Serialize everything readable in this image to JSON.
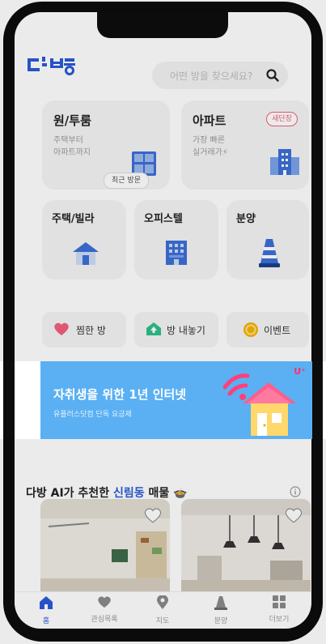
{
  "app": {
    "logo_text": "다방"
  },
  "search": {
    "placeholder": "어떤 방을 찾으세요?"
  },
  "categories": {
    "room": {
      "title": "원/투룸",
      "sub1": "주택부터",
      "sub2": "아파트까지",
      "recent": "최근 방문"
    },
    "apt": {
      "title": "아파트",
      "badge": "새단장",
      "sub1": "가장 빠른",
      "sub2": "실거래가⚡"
    },
    "villa": {
      "title": "주택/빌라"
    },
    "office": {
      "title": "오피스텔"
    },
    "presale": {
      "title": "분양"
    }
  },
  "quick_actions": [
    {
      "label": "찜한 방",
      "icon": "heart-icon",
      "color": "#f0607a"
    },
    {
      "label": "방 내놓기",
      "icon": "house-upload-icon",
      "color": "#2dbf8a"
    },
    {
      "label": "이벤트",
      "icon": "coin-icon",
      "color": "#f5b400"
    }
  ],
  "banner": {
    "title": "자취생을 위한 1년 인터넷",
    "subtitle": "유플러스닷컴 단독 요금제",
    "brand": "U⁺"
  },
  "section": {
    "prefix": "다방 AI가 추천한 ",
    "highlight": "신림동",
    "suffix": " 매물 🍲"
  },
  "tabs": [
    {
      "label": "홈",
      "icon": "home-icon",
      "active": true
    },
    {
      "label": "관심목록",
      "icon": "heart-icon",
      "active": false
    },
    {
      "label": "지도",
      "icon": "map-pin-icon",
      "active": false
    },
    {
      "label": "분양",
      "icon": "cone-icon",
      "active": false
    },
    {
      "label": "더보기",
      "icon": "grid-icon",
      "active": false
    }
  ],
  "colors": {
    "brand": "#2a5bd7",
    "banner": "#5ab0f3",
    "badge": "#f0607a"
  }
}
